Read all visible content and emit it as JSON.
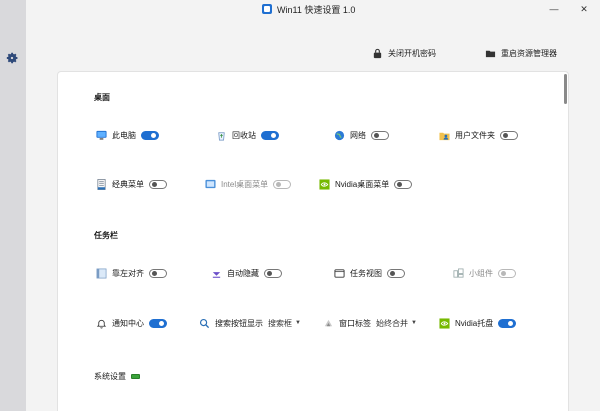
{
  "window": {
    "title": "Win11 快速设置 1.0",
    "minimize_glyph": "—",
    "close_glyph": "✕"
  },
  "topbar": {
    "close_startup_password": "关闭开机密码",
    "restart_explorer": "重启资源管理器"
  },
  "sections": {
    "desktop": "桌面",
    "taskbar": "任务栏",
    "system": "系统设置"
  },
  "desktop_items": [
    {
      "label": "此电脑",
      "icon": "monitor-icon",
      "on": true
    },
    {
      "label": "回收站",
      "icon": "recycle-bin-icon",
      "on": true
    },
    {
      "label": "网络",
      "icon": "network-globe-icon",
      "on": false
    },
    {
      "label": "用户文件夹",
      "icon": "user-folder-icon",
      "on": false
    },
    {
      "label": "经典菜单",
      "icon": "classic-menu-icon",
      "on": false
    },
    {
      "label": "Intel桌面菜单",
      "icon": "intel-icon",
      "on": false,
      "disabled": true
    },
    {
      "label": "Nvidia桌面菜单",
      "icon": "nvidia-icon",
      "on": false
    }
  ],
  "taskbar_items": [
    {
      "label": "靠左对齐",
      "icon": "align-left-icon",
      "on": false
    },
    {
      "label": "自动隐藏",
      "icon": "auto-hide-icon",
      "on": false
    },
    {
      "label": "任务视图",
      "icon": "task-view-icon",
      "on": false
    },
    {
      "label": "小组件",
      "icon": "widgets-icon",
      "on": false,
      "disabled": true
    },
    {
      "label": "通知中心",
      "icon": "bell-icon",
      "on": true
    },
    {
      "label": "搜索按钮显示",
      "icon": "search-icon",
      "select": "搜索框"
    },
    {
      "label": "窗口标签",
      "icon": "window-label-icon",
      "select": "始终合并"
    },
    {
      "label": "Nvidia托盘",
      "icon": "nvidia-icon",
      "on": true
    }
  ],
  "colors": {
    "accent": "#1f6fd1",
    "nvidia_green": "#76b900",
    "system_badge": "#3aa33a"
  }
}
